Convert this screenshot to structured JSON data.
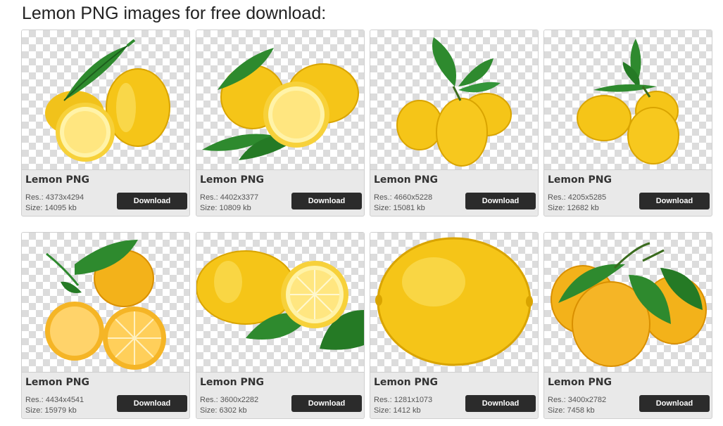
{
  "page": {
    "heading": "Lemon PNG images for free download:"
  },
  "colors": {
    "lemon": "#f5c518",
    "lemon_dark": "#d9a400",
    "leaf": "#2e8a2e",
    "button": "#2b2b2b"
  },
  "cards": [
    {
      "title": "Lemon PNG",
      "res": "Res.: 4373x4294",
      "size": "Size: 14095 kb",
      "button": "Download",
      "image_icon": "lemon-halves-leaf-icon"
    },
    {
      "title": "Lemon PNG",
      "res": "Res.: 4402x3377",
      "size": "Size: 10809 kb",
      "button": "Download",
      "image_icon": "lemons-slice-leaves-icon"
    },
    {
      "title": "Lemon PNG",
      "res": "Res.: 4660x5228",
      "size": "Size: 15081 kb",
      "button": "Download",
      "image_icon": "lemon-bunch-leaves-icon"
    },
    {
      "title": "Lemon PNG",
      "res": "Res.: 4205x5285",
      "size": "Size: 12682 kb",
      "button": "Download",
      "image_icon": "lemon-cluster-leaves-icon"
    },
    {
      "title": "Lemon PNG",
      "res": "Res.: 4434x4541",
      "size": "Size: 15979 kb",
      "button": "Download",
      "image_icon": "orange-lemon-halves-icon"
    },
    {
      "title": "Lemon PNG",
      "res": "Res.: 3600x2282",
      "size": "Size: 6302 kb",
      "button": "Download",
      "image_icon": "lemon-half-leaves-icon"
    },
    {
      "title": "Lemon PNG",
      "res": "Res.: 1281x1073",
      "size": "Size: 1412 kb",
      "button": "Download",
      "image_icon": "whole-lemon-icon"
    },
    {
      "title": "Lemon PNG",
      "res": "Res.: 3400x2782",
      "size": "Size: 7458 kb",
      "button": "Download",
      "image_icon": "wet-lemons-leaves-icon"
    }
  ]
}
